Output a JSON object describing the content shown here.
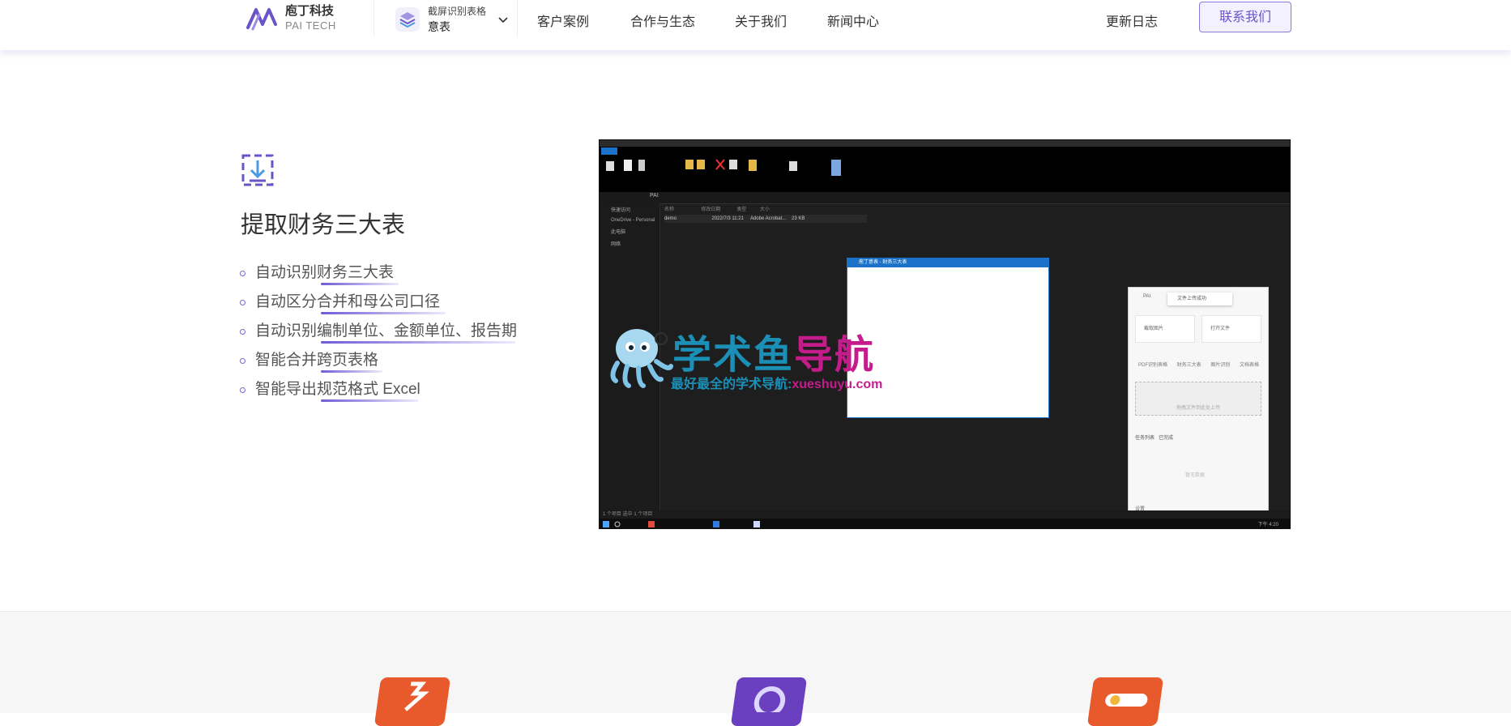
{
  "header": {
    "logo": {
      "cn": "庖丁科技",
      "en": "PAI TECH"
    },
    "product": {
      "subtitle": "截屏识别表格",
      "name": "意表"
    },
    "nav": [
      "客户案例",
      "合作与生态",
      "关于我们",
      "新闻中心"
    ],
    "changelog": "更新日志",
    "contact": "联系我们"
  },
  "feature": {
    "title": "提取财务三大表",
    "items": [
      {
        "prefix": "自动识别",
        "highlight": "财务三大表",
        "suffix": ""
      },
      {
        "prefix": "自动区分",
        "highlight": "合并和母公司口径",
        "suffix": ""
      },
      {
        "prefix": "自动识别",
        "highlight": "编制单位、金额单位、报告期",
        "suffix": ""
      },
      {
        "prefix": "智能合并",
        "highlight": "跨页表格",
        "suffix": ""
      },
      {
        "prefix": "智能导出",
        "highlight": "规范格式",
        "suffix": " Excel"
      }
    ]
  },
  "screenshot": {
    "address": "PAI",
    "sidebar": [
      "快速访问",
      "OneDrive - Personal",
      "此电脑",
      "网络"
    ],
    "columns": "名称                    修改日期            类型          大小",
    "file_row": "demo                          2022/7/3 11:21     Adobe Acrobat...    23 KB",
    "status": "1 个项目   选中 1 个项目",
    "clock": "下午 4:20",
    "dialog_title": "庖丁意表 - 财务三大表",
    "panel": {
      "brand": "PAI",
      "toast": "文件上传成功",
      "card1": "截取图片",
      "card2": "打开文件",
      "tabs": "PDF识别表格 财务三大表 图片识别 文档表格",
      "upload": "拖拽文件到此处上传",
      "tab_row": "任务列表   已完成",
      "empty": "暂无数据",
      "footer": "设置"
    }
  },
  "watermark": {
    "title_main": "学术鱼",
    "title_accent": "导航",
    "sub_main": "最好最全的学术导航:",
    "sub_accent": "xueshuyu.com"
  },
  "colors": {
    "accent": "#6b54c8",
    "icon1": "#e85a2c",
    "icon2": "#6a3fc0",
    "icon3": "#e85a2c"
  }
}
